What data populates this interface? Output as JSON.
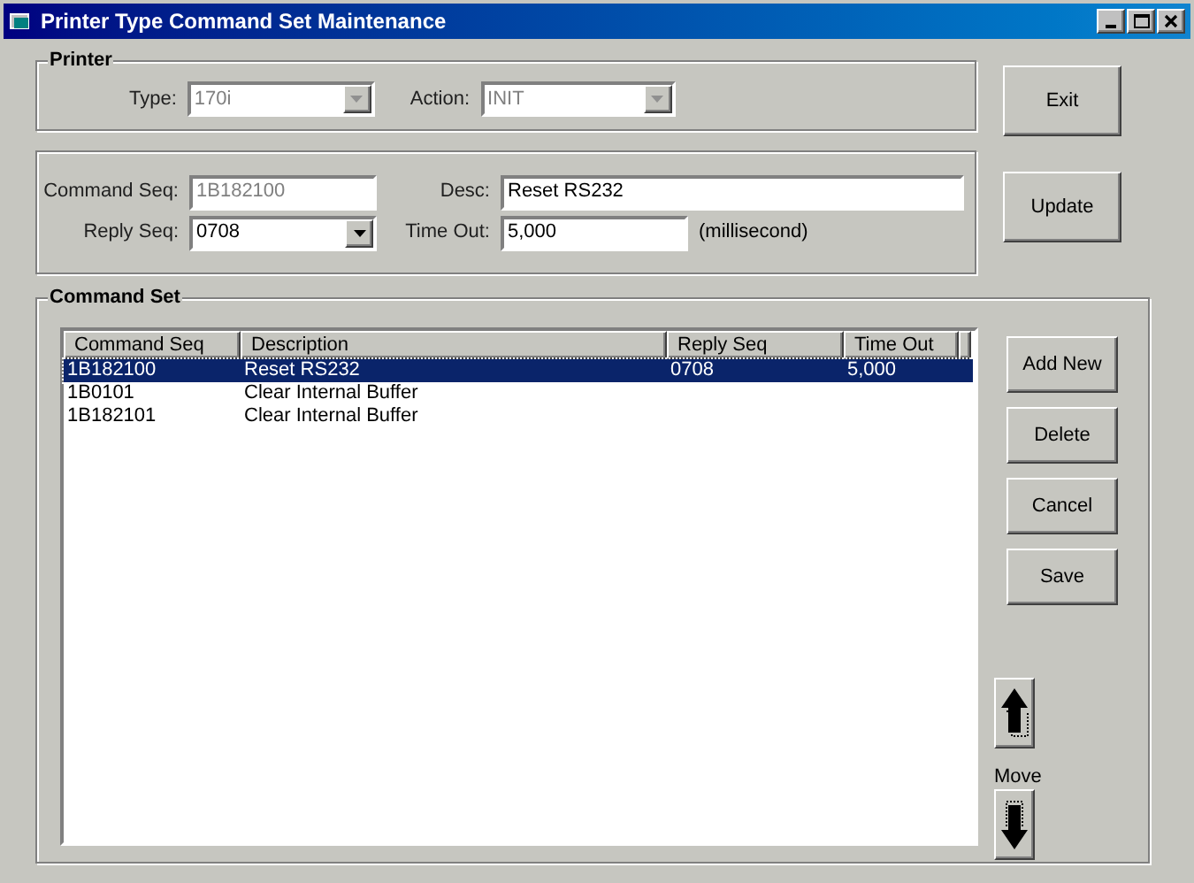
{
  "window": {
    "title": "Printer Type Command Set Maintenance"
  },
  "printer": {
    "title": "Printer",
    "fields": [
      {
        "label": "Type:",
        "value": "170i",
        "kind": "combo",
        "disabled": true
      },
      {
        "label": "Action:",
        "value": "INIT",
        "kind": "combo",
        "disabled": true
      }
    ]
  },
  "exit_button": "Exit",
  "detail": {
    "fields": [
      {
        "label": "Command Seq:",
        "value": "1B182100",
        "kind": "text",
        "disabled": true
      },
      {
        "label": "Desc:",
        "value": "Reset RS232",
        "kind": "text",
        "disabled": false
      },
      {
        "label": "Reply Seq:",
        "value": "0708",
        "kind": "combo",
        "disabled": false
      },
      {
        "label": "Time Out:",
        "value": "5,000",
        "kind": "text",
        "disabled": false,
        "unit": "(millisecond)"
      }
    ]
  },
  "update_button": "Update",
  "command_set": {
    "title": "Command Set",
    "table": {
      "columns": [
        "Command Seq",
        "Description",
        "Reply Seq",
        "Time Out"
      ],
      "rows": [
        {
          "cells": [
            "1B182100",
            "Reset RS232",
            "0708",
            "5,000"
          ],
          "selected": true
        },
        {
          "cells": [
            "1B0101",
            "Clear Internal Buffer",
            "",
            ""
          ],
          "selected": false
        },
        {
          "cells": [
            "1B182101",
            "Clear Internal Buffer",
            "",
            ""
          ],
          "selected": false
        }
      ]
    },
    "buttons": [
      "Add New",
      "Delete",
      "Cancel",
      "Save"
    ],
    "move_label": "Move"
  }
}
